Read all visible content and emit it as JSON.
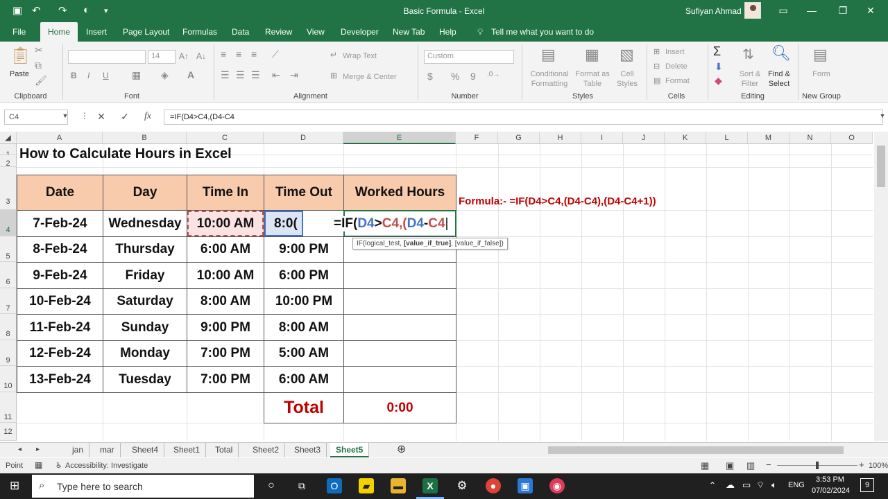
{
  "titlebar": {
    "title": "Basic Formula  -  Excel",
    "user": "Sufiyan Ahmad"
  },
  "ribbon_tabs": [
    "File",
    "Home",
    "Insert",
    "Page Layout",
    "Formulas",
    "Data",
    "Review",
    "View",
    "Developer",
    "New Tab",
    "Help"
  ],
  "active_tab": "Home",
  "tell_me": "Tell me what you want to do",
  "ribbon": {
    "clipboard": {
      "label": "Clipboard",
      "paste": "Paste"
    },
    "font": {
      "label": "Font",
      "size": "14",
      "bold": "B",
      "italic": "I",
      "underline": "U"
    },
    "alignment": {
      "label": "Alignment",
      "wrap": "Wrap Text",
      "merge": "Merge & Center"
    },
    "number": {
      "label": "Number",
      "format": "Custom",
      "currency": "$",
      "percent": "%",
      "comma": "9"
    },
    "styles": {
      "label": "Styles",
      "conditional1": "Conditional",
      "conditional2": "Formatting",
      "table1": "Format as",
      "table2": "Table",
      "cell1": "Cell",
      "cell2": "Styles"
    },
    "cells": {
      "label": "Cells",
      "insert": "Insert",
      "delete": "Delete",
      "format": "Format"
    },
    "editing": {
      "label": "Editing",
      "sort1": "Sort &",
      "sort2": "Filter",
      "find1": "Find &",
      "find2": "Select"
    },
    "newgroup": {
      "label": "New Group",
      "form": "Form"
    }
  },
  "formula_bar": {
    "name_box": "C4",
    "cancel": "✕",
    "enter": "✓",
    "fx": "fx",
    "formula": "=IF(D4>C4,(D4-C4"
  },
  "columns": [
    "A",
    "B",
    "C",
    "D",
    "E",
    "F",
    "G",
    "H",
    "I",
    "J",
    "K",
    "L",
    "M",
    "N",
    "O"
  ],
  "rows": [
    "1",
    "2",
    "3",
    "4",
    "5",
    "6",
    "7",
    "8",
    "9",
    "10",
    "11",
    "12"
  ],
  "sheet": {
    "title": "How to Calculate Hours in Excel",
    "headers": [
      "Date",
      "Day",
      "Time In",
      "Time Out",
      "Worked Hours"
    ],
    "data": [
      {
        "date": "7-Feb-24",
        "day": "Wednesday",
        "in": "10:00 AM",
        "out": "8:0("
      },
      {
        "date": "8-Feb-24",
        "day": "Thursday",
        "in": "6:00 AM",
        "out": "9:00 PM"
      },
      {
        "date": "9-Feb-24",
        "day": "Friday",
        "in": "10:00 AM",
        "out": "6:00 PM"
      },
      {
        "date": "10-Feb-24",
        "day": "Saturday",
        "in": "8:00 AM",
        "out": "10:00 PM"
      },
      {
        "date": "11-Feb-24",
        "day": "Sunday",
        "in": "9:00 PM",
        "out": "8:00 AM"
      },
      {
        "date": "12-Feb-24",
        "day": "Monday",
        "in": "7:00 PM",
        "out": "5:00 AM"
      },
      {
        "date": "13-Feb-24",
        "day": "Tuesday",
        "in": "7:00 PM",
        "out": "6:00 AM"
      }
    ],
    "total_label": "Total",
    "total_value": "0:00",
    "note": "Formula:-  =IF(D4>C4,(D4-C4),(D4-C4+1))",
    "edit_parts": [
      "=IF(",
      "D4",
      ">",
      "C4",
      ",(",
      "D4",
      "-",
      "C4"
    ],
    "tooltip_a": "IF(logical_test, ",
    "tooltip_b": "[value_if_true]",
    "tooltip_c": ", [value_if_false])"
  },
  "sheet_tabs": [
    "jan",
    "mar",
    "Sheet4",
    "Sheet1",
    "Total",
    "Sheet2",
    "Sheet3",
    "Sheet5"
  ],
  "active_sheet": "Sheet5",
  "status": {
    "mode": "Point",
    "accessibility": "Accessibility: Investigate",
    "zoom": "100%"
  },
  "taskbar": {
    "search": "Type here to search",
    "time": "3:53 PM",
    "date": "07/02/2024",
    "lang": "ENG",
    "badge": "9"
  },
  "colors": {
    "excel_green": "#217346",
    "header_fill": "#f8cbad",
    "red_text": "#c00000",
    "ref_blue": "#4472c4",
    "ref_red": "#c0504d"
  }
}
